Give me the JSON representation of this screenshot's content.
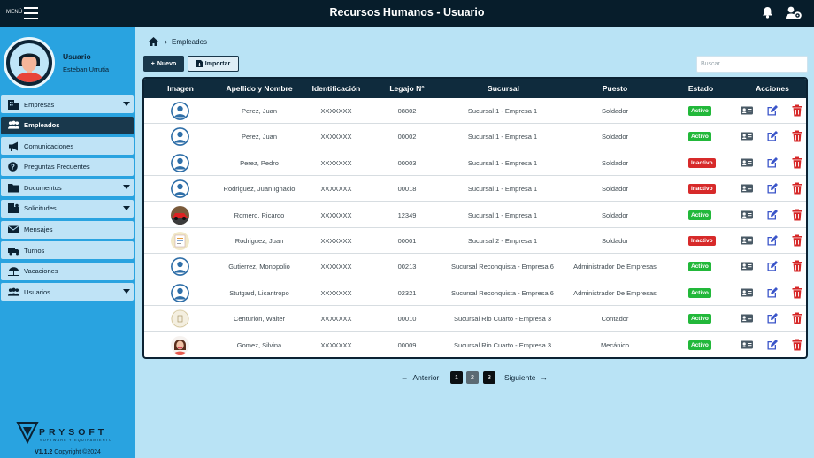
{
  "topbar": {
    "menu_label": "MENÚ",
    "title": "Recursos Humanos - Usuario"
  },
  "profile": {
    "role": "Usuario",
    "name": "Esteban Urrutia"
  },
  "sidebar": {
    "items": [
      {
        "label": "Empresas",
        "icon": "building-icon",
        "expandable": true,
        "active": false
      },
      {
        "label": "Empleados",
        "icon": "users-icon",
        "expandable": false,
        "active": true
      },
      {
        "label": "Comunicaciones",
        "icon": "megaphone-icon",
        "expandable": false,
        "active": false
      },
      {
        "label": "Preguntas Frecuentes",
        "icon": "question-icon",
        "expandable": false,
        "active": false
      },
      {
        "label": "Documentos",
        "icon": "folder-icon",
        "expandable": true,
        "active": false
      },
      {
        "label": "Solicitudes",
        "icon": "requests-icon",
        "expandable": true,
        "active": false
      },
      {
        "label": "Mensajes",
        "icon": "envelope-icon",
        "expandable": false,
        "active": false
      },
      {
        "label": "Turnos",
        "icon": "truck-icon",
        "expandable": false,
        "active": false
      },
      {
        "label": "Vacaciones",
        "icon": "umbrella-beach-icon",
        "expandable": false,
        "active": false
      },
      {
        "label": "Usuarios",
        "icon": "users-icon",
        "expandable": true,
        "active": false
      }
    ],
    "brand": {
      "name": "PRYSOFT",
      "tagline": "SOFTWARE Y EQUIPAMIENTO"
    },
    "version": "V1.1.2",
    "copyright": "Copyright ©2024"
  },
  "breadcrumb": {
    "current": "Empleados"
  },
  "toolbar": {
    "new_label": "Nuevo",
    "import_label": "Importar",
    "search_placeholder": "Buscar..."
  },
  "table": {
    "headers": [
      "Imagen",
      "Apellido y Nombre",
      "Identificación",
      "Legajo N°",
      "Sucursal",
      "Puesto",
      "Estado",
      "Acciones"
    ],
    "rows": [
      {
        "photo": "default-avatar",
        "name": "Perez, Juan",
        "id": "XXXXXXX",
        "legajo": "08802",
        "sucursal": "Sucursal 1 - Empresa 1",
        "puesto": "Soldador",
        "estado": "Activo"
      },
      {
        "photo": "default-avatar",
        "name": "Perez, Juan",
        "id": "XXXXXXX",
        "legajo": "00002",
        "sucursal": "Sucursal 1 - Empresa 1",
        "puesto": "Soldador",
        "estado": "Activo"
      },
      {
        "photo": "default-avatar",
        "name": "Perez, Pedro",
        "id": "XXXXXXX",
        "legajo": "00003",
        "sucursal": "Sucursal 1 - Empresa 1",
        "puesto": "Soldador",
        "estado": "Inactivo"
      },
      {
        "photo": "default-avatar",
        "name": "Rodriguez, Juan Ignacio",
        "id": "XXXXXXX",
        "legajo": "00018",
        "sucursal": "Sucursal 1 - Empresa 1",
        "puesto": "Soldador",
        "estado": "Inactivo"
      },
      {
        "photo": "car-photo",
        "name": "Romero, Ricardo",
        "id": "XXXXXXX",
        "legajo": "12349",
        "sucursal": "Sucursal 1 - Empresa 1",
        "puesto": "Soldador",
        "estado": "Activo"
      },
      {
        "photo": "document-photo",
        "name": "Rodriguez, Juan",
        "id": "XXXXXXX",
        "legajo": "00001",
        "sucursal": "Sucursal 2 - Empresa 1",
        "puesto": "Soldador",
        "estado": "Inactivo"
      },
      {
        "photo": "default-avatar",
        "name": "Gutierrez, Monopolio",
        "id": "XXXXXXX",
        "legajo": "00213",
        "sucursal": "Sucursal Reconquista - Empresa 6",
        "puesto": "Administrador De Empresas",
        "estado": "Activo"
      },
      {
        "photo": "default-avatar",
        "name": "Stutgard, Licantropo",
        "id": "XXXXXXX",
        "legajo": "02321",
        "sucursal": "Sucursal Reconquista - Empresa 6",
        "puesto": "Administrador De Empresas",
        "estado": "Activo"
      },
      {
        "photo": "logo-photo",
        "name": "Centurion, Walter",
        "id": "XXXXXXX",
        "legajo": "00010",
        "sucursal": "Sucursal Rio Cuarto - Empresa 3",
        "puesto": "Contador",
        "estado": "Activo"
      },
      {
        "photo": "woman-photo",
        "name": "Gomez, Silvina",
        "id": "XXXXXXX",
        "legajo": "00009",
        "sucursal": "Sucursal Rio Cuarto - Empresa 3",
        "puesto": "Mecánico",
        "estado": "Activo"
      }
    ]
  },
  "pagination": {
    "prev": "Anterior",
    "next": "Siguiente",
    "pages": [
      "1",
      "2",
      "3"
    ],
    "current": "2"
  },
  "colors": {
    "topbar": "#071d2b",
    "sidebar": "#29a3e0",
    "background": "#b9e3f5",
    "active_badge": "#22b83a",
    "inactive_badge": "#d72a2a",
    "edit_icon": "#3b55c9",
    "delete_icon": "#d62828"
  }
}
